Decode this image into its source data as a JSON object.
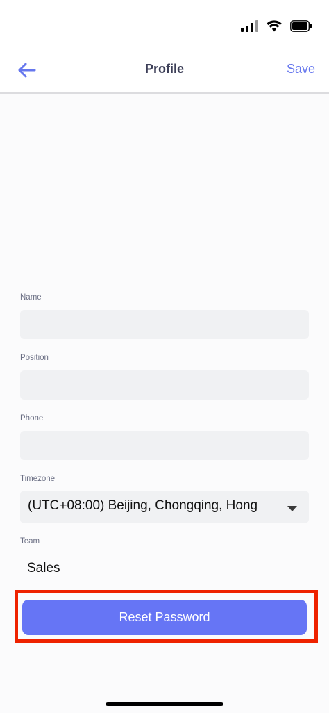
{
  "header": {
    "title": "Profile",
    "save_label": "Save",
    "back_icon": "arrow-left-icon"
  },
  "status_bar": {
    "icons": [
      "cellular-signal-icon",
      "wifi-icon",
      "battery-icon"
    ]
  },
  "form": {
    "name": {
      "label": "Name",
      "value": ""
    },
    "position": {
      "label": "Position",
      "value": ""
    },
    "phone": {
      "label": "Phone",
      "value": ""
    },
    "timezone": {
      "label": "Timezone",
      "value": "(UTC+08:00) Beijing, Chongqing, Hong"
    },
    "team": {
      "label": "Team",
      "value": "Sales"
    }
  },
  "actions": {
    "reset_password_label": "Reset Password"
  },
  "colors": {
    "accent": "#6675f5",
    "link": "#6677ee",
    "highlight": "#ee2200",
    "input_bg": "#f0f1f3"
  }
}
